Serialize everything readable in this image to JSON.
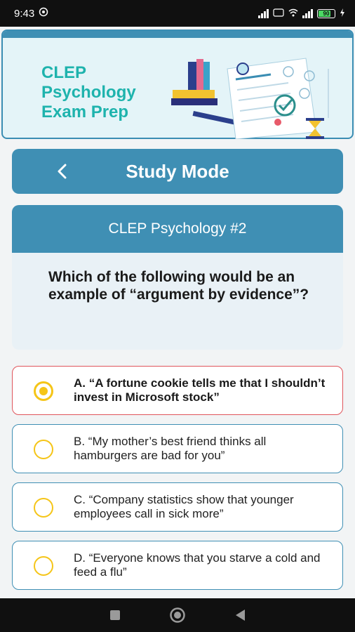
{
  "status_bar": {
    "time": "9:43",
    "battery_level": "90",
    "icons": [
      "notification-icon",
      "signal-icon",
      "wifi-icon",
      "4g-icon",
      "battery-icon",
      "charging-icon"
    ]
  },
  "banner": {
    "title_line1": "CLEP",
    "title_line2": "Psychology",
    "title_line3": "Exam Prep"
  },
  "study_bar": {
    "title": "Study Mode"
  },
  "question": {
    "header": "CLEP Psychology #2",
    "text": "Which of the following would be an example of “argument by evidence”?"
  },
  "options": [
    {
      "label": "A. “A fortune cookie tells me that I shouldn’t invest in Microsoft stock”",
      "selected": true
    },
    {
      "label": "B. “My mother’s best friend thinks all hamburgers are bad for you”",
      "selected": false
    },
    {
      "label": "C. “Company statistics show that younger employees call in sick more”",
      "selected": false
    },
    {
      "label": "D. “Everyone knows that you starve a cold and feed a flu”",
      "selected": false
    }
  ],
  "colors": {
    "primary": "#3f8fb4",
    "title_teal": "#1eb3ad",
    "radio_yellow": "#f5c518",
    "selected_border": "#e0555b"
  }
}
